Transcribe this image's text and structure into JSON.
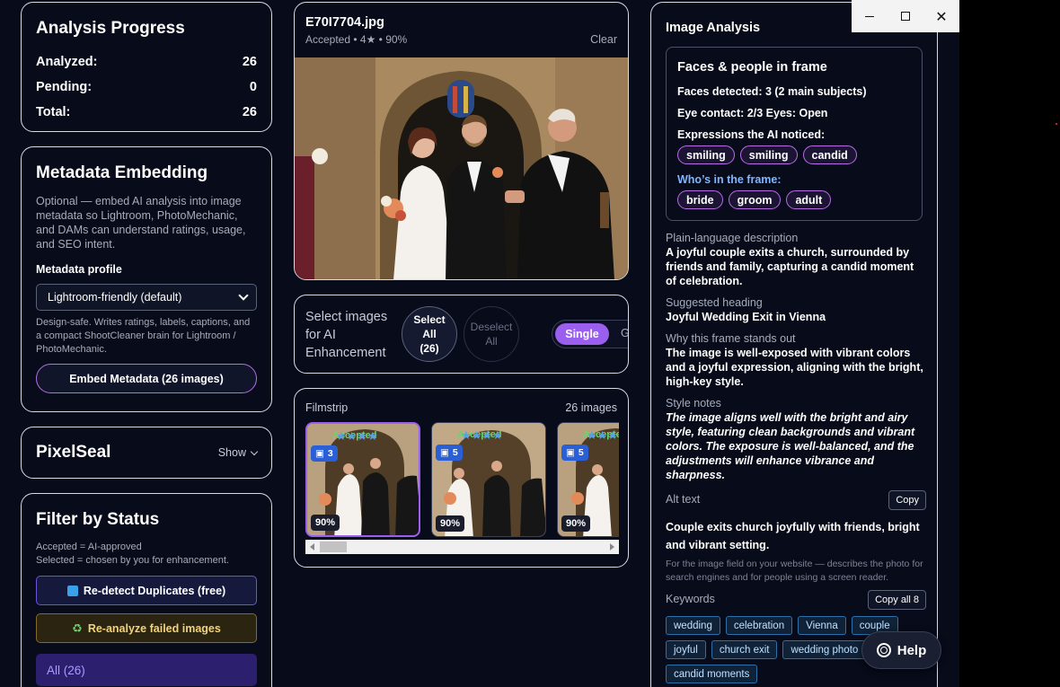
{
  "window": {
    "close_glyph": "✕"
  },
  "progress": {
    "title": "Analysis Progress",
    "rows": [
      {
        "label": "Analyzed:",
        "value": "26"
      },
      {
        "label": "Pending:",
        "value": "0"
      },
      {
        "label": "Total:",
        "value": "26"
      }
    ]
  },
  "metadata": {
    "title": "Metadata Embedding",
    "description": "Optional — embed AI analysis into image metadata so Lightroom, PhotoMechanic, and DAMs can understand ratings, usage, and SEO intent.",
    "profile_label": "Metadata profile",
    "profile_value": "Lightroom-friendly (default)",
    "profile_hint": "Design-safe. Writes ratings, labels, captions, and a compact ShootCleaner brain for Lightroom / PhotoMechanic.",
    "embed_button": "Embed Metadata (26 images)"
  },
  "pixelseal": {
    "title": "PixelSeal",
    "toggle": "Show"
  },
  "filter": {
    "title": "Filter by Status",
    "desc_line1": "Accepted = AI-approved",
    "desc_line2": "Selected = chosen by you for enhancement.",
    "redetect_button": "Re-detect Duplicates (free)",
    "reanalyze_button": "Re-analyze failed images",
    "all_tab": "All (26)"
  },
  "viewer": {
    "filename": "E70I7704.jpg",
    "subtitle": "Accepted • 4★ • 90%",
    "clear": "Clear"
  },
  "selection": {
    "label": "Select images for AI Enhancement",
    "select_all_line1": "Select",
    "select_all_line2": "All",
    "select_all_line3": "(26)",
    "deselect_line1": "Deselect",
    "deselect_line2": "All",
    "mode_single": "Single",
    "mode_grid": "Grid"
  },
  "filmstrip": {
    "label": "Filmstrip",
    "count": "26 images",
    "items": [
      {
        "accepted": "Accepted",
        "stars": "★★★★",
        "dup_count": "3",
        "score": "90%"
      },
      {
        "accepted": "Accepted",
        "stars": "★★★★",
        "dup_count": "5",
        "score": "90%"
      },
      {
        "accepted": "Accepted",
        "stars": "★★★★",
        "dup_count": "5",
        "score": "90%"
      }
    ]
  },
  "analysis": {
    "title": "Image Analysis",
    "faces_title": "Faces & people in frame",
    "faces_detected": "Faces detected: 3  (2 main subjects)",
    "eye_contact": "Eye contact: 2/3    Eyes: Open",
    "expressions_label": "Expressions the AI noticed:",
    "expressions": [
      "smiling",
      "smiling",
      "candid"
    ],
    "who_label": "Who’s in the frame:",
    "who": [
      "bride",
      "groom",
      "adult"
    ],
    "description_label": "Plain-language description",
    "description": "A joyful couple exits a church, surrounded by friends and family, capturing a candid moment of celebration.",
    "heading_label": "Suggested heading",
    "heading": "Joyful Wedding Exit in Vienna",
    "why_label": "Why this frame stands out",
    "why": "The image is well-exposed with vibrant colors and a joyful expression, aligning with the bright, high-key style.",
    "style_label": "Style notes",
    "style": "The image aligns well with the bright and airy style, featuring clean backgrounds and vibrant colors. The exposure is well-balanced, and the adjustments will enhance vibrance and sharpness.",
    "alt_label": "Alt text",
    "alt_copy": "Copy",
    "alt_text": "Couple exits church joyfully with friends, bright and vibrant setting.",
    "alt_hint": "For the image field on your website — describes the photo for search engines and for people using a screen reader.",
    "keywords_label": "Keywords",
    "keywords_copy": "Copy all 8",
    "keywords": [
      "wedding",
      "celebration",
      "Vienna",
      "couple",
      "joyful",
      "church exit",
      "wedding photo",
      "candid moments"
    ]
  },
  "help": {
    "label": "Help"
  }
}
